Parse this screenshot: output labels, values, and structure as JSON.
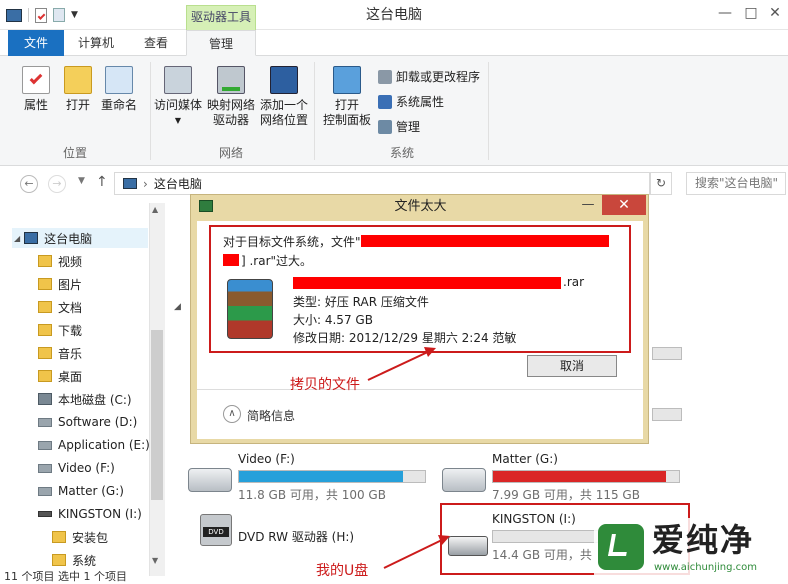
{
  "window": {
    "title": "这台电脑",
    "context_tab": "驱动器工具",
    "minimize": "—",
    "maximize": "□",
    "close": "✕"
  },
  "ribbon_tabs": {
    "file": "文件",
    "computer": "计算机",
    "view": "查看",
    "manage": "管理"
  },
  "ribbon": {
    "properties": "属性",
    "open": "打开",
    "rename": "重命名",
    "access_media": "访问媒体",
    "map_drive_1": "映射网络",
    "map_drive_2": "驱动器",
    "add_location_1": "添加一个",
    "add_location_2": "网络位置",
    "open_cp_1": "打开",
    "open_cp_2": "控制面板",
    "uninstall": "卸载或更改程序",
    "system_props": "系统属性",
    "manage": "管理",
    "group_location": "位置",
    "group_network": "网络",
    "group_system": "系统"
  },
  "address": {
    "path": "这台电脑",
    "search_placeholder": "搜索\"这台电脑\"",
    "back": "←",
    "forward": "→",
    "up": "↑",
    "refresh": "↻"
  },
  "sidebar": {
    "items": [
      {
        "label": "这台电脑"
      },
      {
        "label": "视频"
      },
      {
        "label": "图片"
      },
      {
        "label": "文档"
      },
      {
        "label": "下载"
      },
      {
        "label": "音乐"
      },
      {
        "label": "桌面"
      },
      {
        "label": "本地磁盘 (C:)"
      },
      {
        "label": "Software (D:)"
      },
      {
        "label": "Application (E:)"
      },
      {
        "label": "Video (F:)"
      },
      {
        "label": "Matter (G:)"
      },
      {
        "label": "KINGSTON (I:)"
      },
      {
        "label": "安装包"
      },
      {
        "label": "系统"
      }
    ]
  },
  "drives": {
    "video": {
      "name": "Video (F:)",
      "free": "11.8 GB 可用，共 100 GB",
      "used_fraction": 0.882
    },
    "matter": {
      "name": "Matter (G:)",
      "free": "7.99 GB 可用，共 115 GB",
      "used_fraction": 0.93
    },
    "dvd": {
      "name": "DVD RW 驱动器 (H:)",
      "badge": "DVD"
    },
    "kingston": {
      "name": "KINGSTON (I:)",
      "free": "14.4 GB 可用，共"
    }
  },
  "dialog": {
    "title": "文件太大",
    "message_prefix": "对于目标文件系统，文件\"",
    "message_suffix": "] .rar\"过大。",
    "file_ext": ".rar",
    "type": "类型: 好压 RAR 压缩文件",
    "size": "大小: 4.57 GB",
    "modified": "修改日期: 2012/12/29 星期六 2:24  范敏",
    "cancel": "取消",
    "details": "简略信息",
    "details_icon": "∧"
  },
  "annotations": {
    "copied_file": "拷贝的文件",
    "my_usb": "我的U盘"
  },
  "watermark": {
    "text": "爱纯净",
    "url": "www.aichunjing.com"
  },
  "status": {
    "text": "11 个项目    选中 1 个项目"
  },
  "colors": {
    "accent": "#1a70c1",
    "bar_normal": "#26a0da",
    "bar_full": "#da2626",
    "annotation_red": "#cc1b1b",
    "dialog_frame": "#e8d9a6"
  }
}
